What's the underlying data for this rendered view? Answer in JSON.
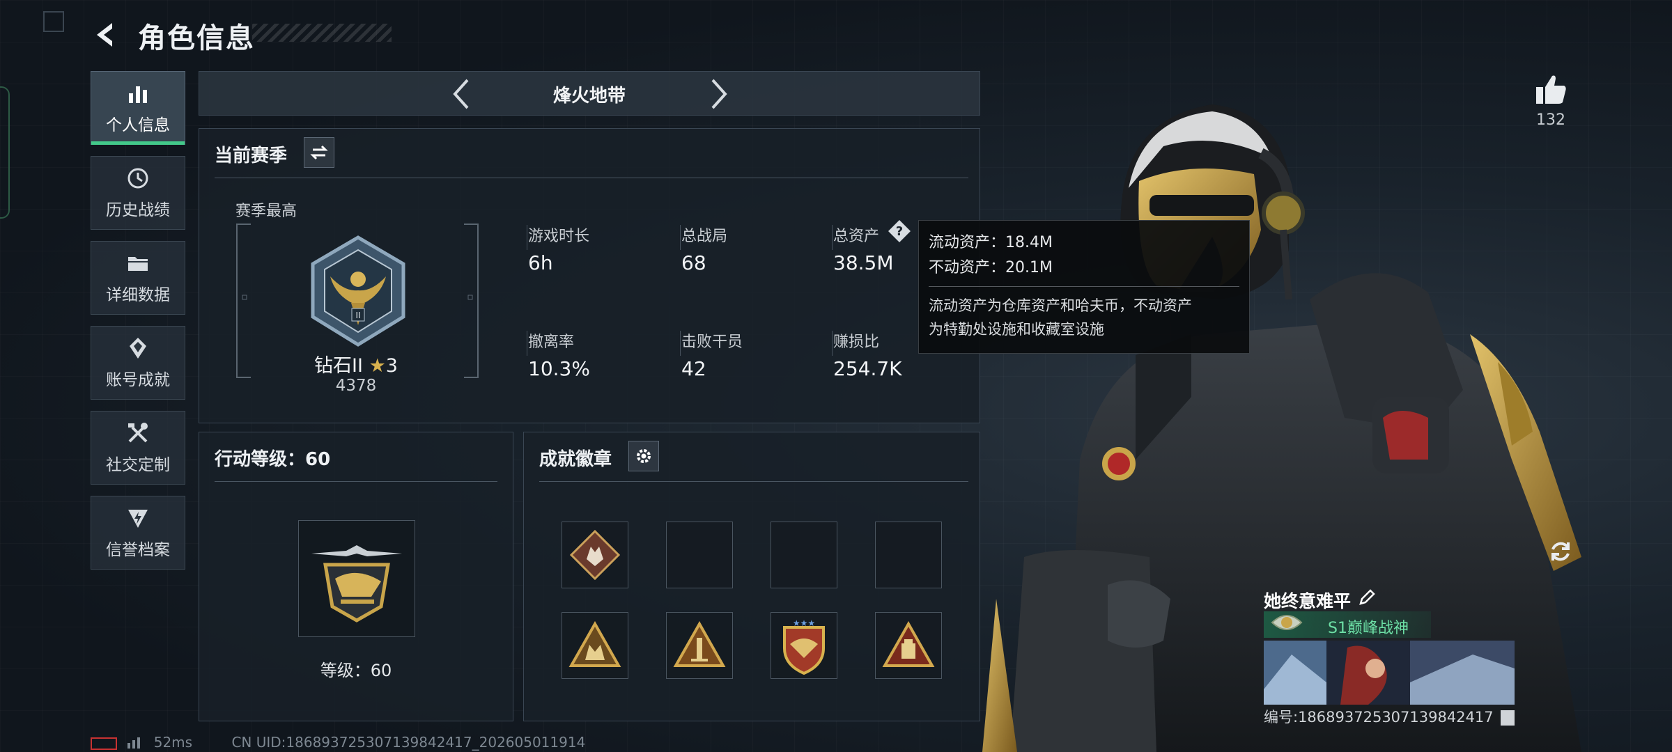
{
  "header": {
    "title": "角色信息"
  },
  "nav": {
    "items": [
      {
        "label": "个人信息",
        "icon": "bar-chart-icon",
        "active": true
      },
      {
        "label": "历史战绩",
        "icon": "clock-icon",
        "active": false
      },
      {
        "label": "详细数据",
        "icon": "folder-icon",
        "active": false
      },
      {
        "label": "账号成就",
        "icon": "medal-icon",
        "active": false
      },
      {
        "label": "社交定制",
        "icon": "tools-icon",
        "active": false
      },
      {
        "label": "信誉档案",
        "icon": "shield-bolt-icon",
        "active": false
      }
    ]
  },
  "mode": {
    "title": "烽火地带"
  },
  "season": {
    "title": "当前赛季",
    "best_label": "赛季最高",
    "rank_name": "钻石II",
    "rank_stars": "3",
    "rank_points": "4378",
    "stats": [
      {
        "label": "游戏时长",
        "value": "6h"
      },
      {
        "label": "总战局",
        "value": "68"
      },
      {
        "label": "总资产",
        "value": "38.5M"
      },
      {
        "label": "撤离率",
        "value": "10.3%"
      },
      {
        "label": "击败干员",
        "value": "42"
      },
      {
        "label": "赚损比",
        "value": "254.7K"
      }
    ]
  },
  "tooltip": {
    "liquid": "流动资产：18.4M",
    "fixed": "不动资产：20.1M",
    "note_line1": "流动资产为仓库资产和哈夫币，不动资产",
    "note_line2": "为特勤处设施和收藏室设施"
  },
  "action_level": {
    "title": "行动等级：60",
    "level_text": "等级：60"
  },
  "badges": {
    "title": "成就徽章"
  },
  "profile": {
    "likes": "132",
    "name": "她终意难平",
    "title_badge": "S1巅峰战神",
    "uid_line": "编号:1868937253071398424​17"
  },
  "footer": {
    "latency": "52ms",
    "uid": "CN UID:1868937253071398424​17_202605011914"
  },
  "colors": {
    "accent_green": "#43c98a",
    "gold": "#c9a54a"
  }
}
